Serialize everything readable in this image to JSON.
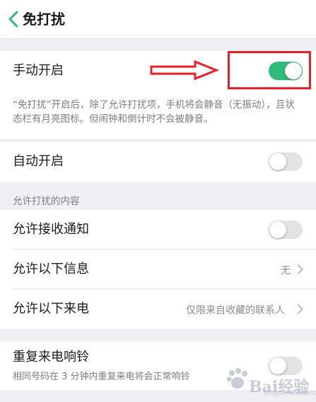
{
  "header": {
    "title": "免打扰"
  },
  "manual": {
    "label": "手动开启",
    "on": true,
    "description": "“免打扰”开启后，除了允许打扰项，手机将会静音（无振动），且状态栏有月亮图标。但闹钟和倒计时不会被静音。"
  },
  "auto": {
    "label": "自动开启",
    "on": false
  },
  "section_header": "允许打扰的内容",
  "allow": {
    "notify_label": "允许接收通知",
    "notify_on": false,
    "messages_label": "允许以下信息",
    "messages_value": "无",
    "calls_label": "允许以下来电",
    "calls_value": "仅限来自收藏的联系人"
  },
  "repeat": {
    "label": "重复来电响铃",
    "sublabel": "相同号码在 3 分钟内重复来电将会正常响铃",
    "on": false
  },
  "watermark": {
    "text": "Bai经验",
    "url": "jingyan.baidu.com"
  },
  "colors": {
    "accent_on": "#2fbb7a",
    "annotation": "#e8202a"
  }
}
